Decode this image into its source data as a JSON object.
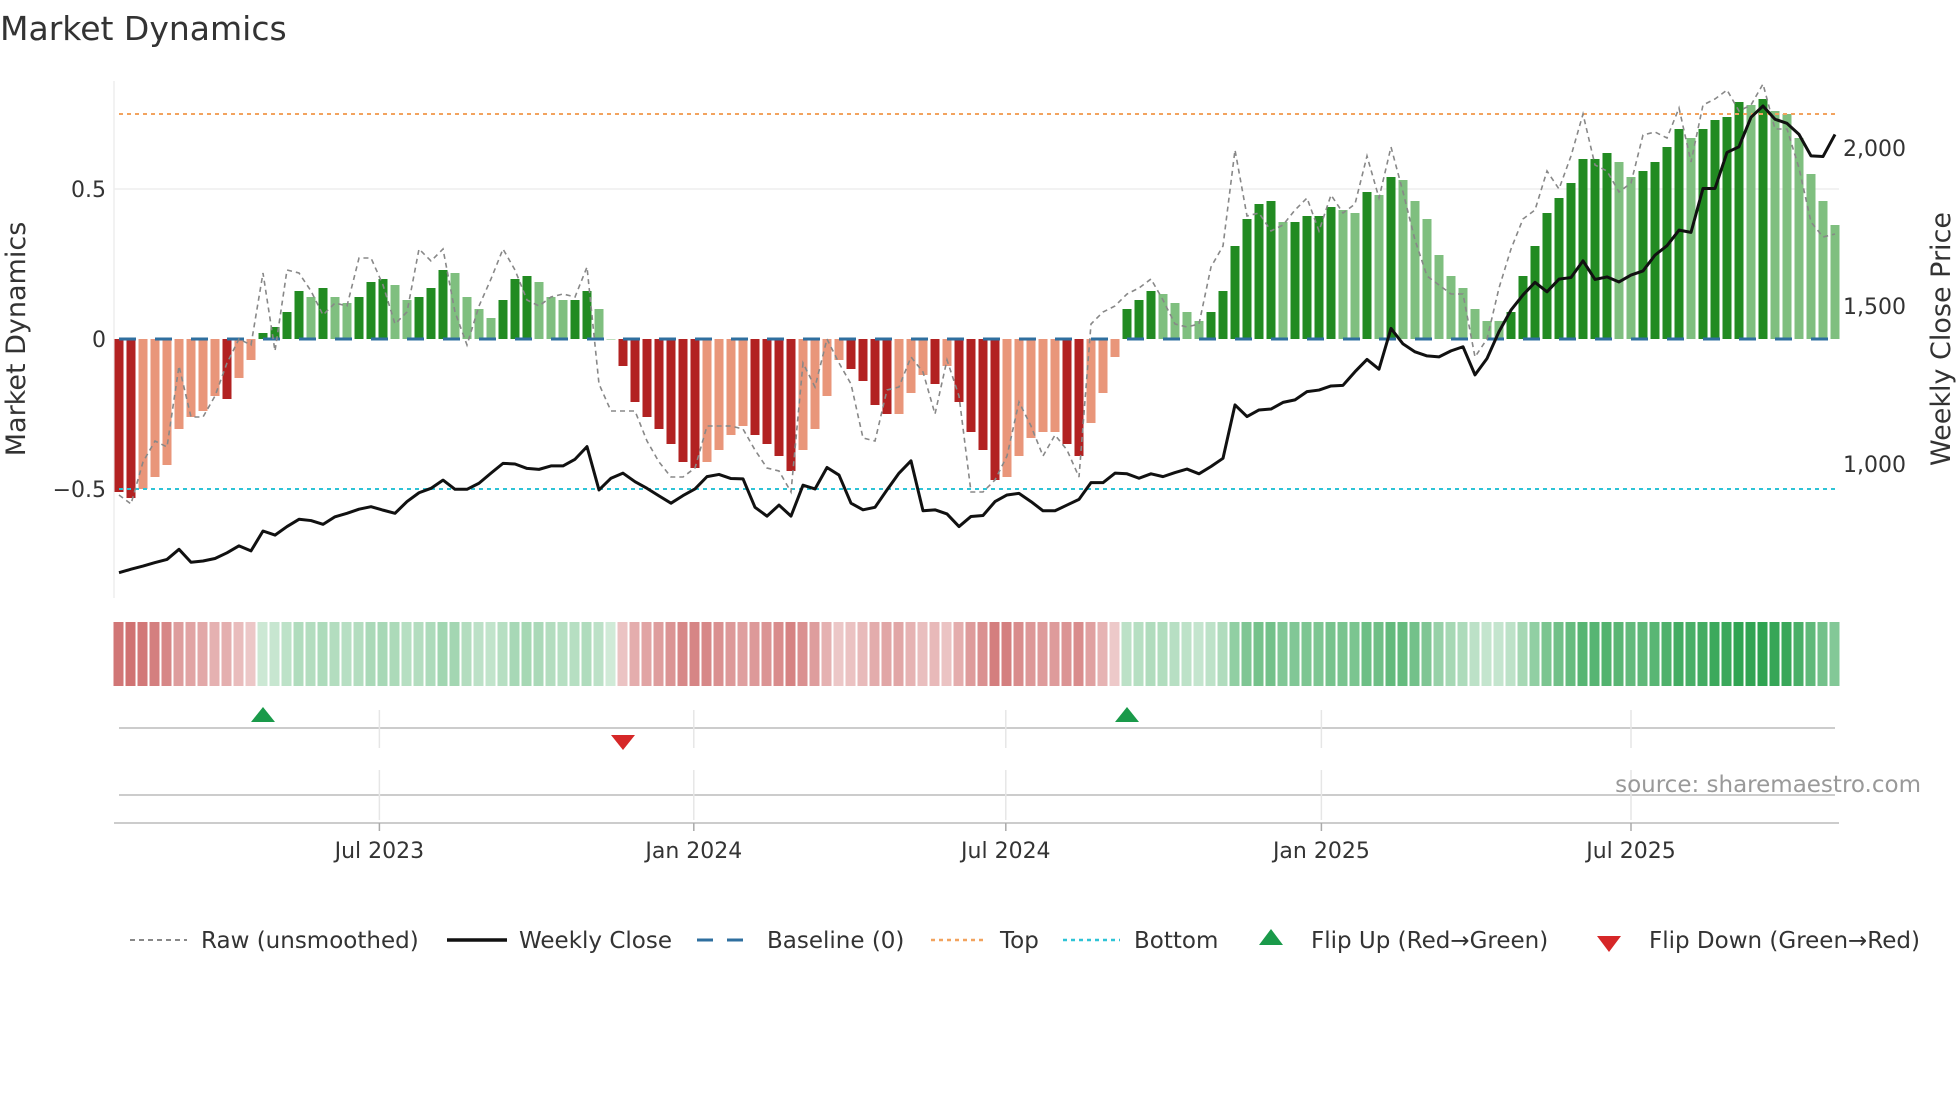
{
  "title": "Market Dynamics",
  "source": "source: sharemaestro.com",
  "colors": {
    "dark_red": "#b22222",
    "light_red": "#e9967a",
    "dark_green": "#228b22",
    "light_green": "#7fbf7f",
    "baseline": "#2f6f9f",
    "top": "#f2a35e",
    "bottom": "#2ec3d6",
    "price": "#111111",
    "raw": "#888888",
    "flip_up": "#1a9a4a",
    "flip_down": "#d62728"
  },
  "chart_data": {
    "type": "bar",
    "title": "Market Dynamics",
    "ylabel": "Market Dynamics",
    "y2label": "Weekly Close Price",
    "ylim": [
      -0.62,
      0.87
    ],
    "y_ticks": [
      {
        "value": 0.5,
        "label": "0.5"
      },
      {
        "value": 0,
        "label": "0"
      },
      {
        "value": -0.5,
        "label": "−0.5"
      }
    ],
    "y2_ticks": [
      {
        "value": 2000,
        "label": "2,000"
      },
      {
        "value": 1500,
        "label": "1,500"
      },
      {
        "value": 1000,
        "label": "1,000"
      }
    ],
    "x_ticks": [
      {
        "week_index": 21.7,
        "label": "Jul 2023"
      },
      {
        "week_index": 47.9,
        "label": "Jan 2024"
      },
      {
        "week_index": 73.9,
        "label": "Jul 2024"
      },
      {
        "week_index": 100.2,
        "label": "Jan 2025"
      },
      {
        "week_index": 126.0,
        "label": "Jul 2025"
      }
    ],
    "thresholds": {
      "baseline": 0,
      "top": 0.75,
      "bottom": -0.5
    },
    "smoothed": [
      -0.51,
      -0.53,
      -0.5,
      -0.46,
      -0.42,
      -0.3,
      -0.26,
      -0.24,
      -0.19,
      -0.2,
      -0.13,
      -0.07,
      0.02,
      0.04,
      0.09,
      0.16,
      0.14,
      0.17,
      0.14,
      0.12,
      0.14,
      0.19,
      0.2,
      0.18,
      0.13,
      0.14,
      0.17,
      0.23,
      0.22,
      0.14,
      0.1,
      0.07,
      0.13,
      0.2,
      0.21,
      0.19,
      0.14,
      0.13,
      0.13,
      0.16,
      0.1,
      0.0,
      -0.09,
      -0.21,
      -0.26,
      -0.3,
      -0.35,
      -0.41,
      -0.43,
      -0.41,
      -0.37,
      -0.32,
      -0.29,
      -0.32,
      -0.35,
      -0.39,
      -0.44,
      -0.37,
      -0.3,
      -0.19,
      -0.07,
      -0.1,
      -0.14,
      -0.22,
      -0.25,
      -0.25,
      -0.18,
      -0.12,
      -0.15,
      -0.09,
      -0.21,
      -0.31,
      -0.37,
      -0.47,
      -0.46,
      -0.39,
      -0.33,
      -0.31,
      -0.31,
      -0.35,
      -0.39,
      -0.28,
      -0.18,
      -0.06,
      0.1,
      0.13,
      0.16,
      0.15,
      0.12,
      0.09,
      0.06,
      0.09,
      0.16,
      0.31,
      0.4,
      0.45,
      0.46,
      0.39,
      0.39,
      0.41,
      0.41,
      0.44,
      0.43,
      0.42,
      0.49,
      0.48,
      0.54,
      0.53,
      0.46,
      0.4,
      0.28,
      0.21,
      0.17,
      0.1,
      0.06,
      0.06,
      0.09,
      0.21,
      0.31,
      0.42,
      0.47,
      0.52,
      0.6,
      0.6,
      0.62,
      0.59,
      0.54,
      0.56,
      0.59,
      0.64,
      0.7,
      0.67,
      0.7,
      0.73,
      0.74,
      0.79,
      0.78,
      0.8,
      0.76,
      0.75,
      0.67,
      0.55,
      0.46,
      0.38
    ],
    "strong": [
      1,
      1,
      0,
      0,
      0,
      0,
      0,
      0,
      0,
      1,
      0,
      0,
      1,
      1,
      1,
      1,
      0,
      1,
      0,
      0,
      1,
      1,
      1,
      0,
      0,
      1,
      1,
      1,
      0,
      0,
      0,
      0,
      1,
      1,
      1,
      0,
      0,
      0,
      1,
      1,
      0,
      0,
      1,
      1,
      1,
      1,
      1,
      1,
      1,
      0,
      0,
      0,
      0,
      1,
      1,
      1,
      1,
      0,
      0,
      0,
      0,
      1,
      1,
      1,
      1,
      0,
      0,
      0,
      1,
      0,
      1,
      1,
      1,
      1,
      0,
      0,
      0,
      0,
      0,
      1,
      1,
      0,
      0,
      0,
      1,
      1,
      1,
      0,
      0,
      0,
      0,
      1,
      1,
      1,
      1,
      1,
      1,
      0,
      1,
      1,
      1,
      1,
      0,
      0,
      1,
      0,
      1,
      0,
      0,
      0,
      0,
      0,
      0,
      0,
      0,
      0,
      1,
      1,
      1,
      1,
      1,
      1,
      1,
      1,
      1,
      0,
      0,
      1,
      1,
      1,
      1,
      0,
      1,
      1,
      1,
      1,
      0,
      1,
      0,
      0,
      0,
      0,
      0,
      0
    ],
    "raw": [
      -0.52,
      -0.55,
      -0.41,
      -0.34,
      -0.36,
      -0.09,
      -0.26,
      -0.26,
      -0.19,
      -0.08,
      0.0,
      -0.02,
      0.22,
      -0.04,
      0.23,
      0.22,
      0.16,
      0.08,
      0.12,
      0.11,
      0.27,
      0.27,
      0.18,
      0.05,
      0.09,
      0.3,
      0.26,
      0.3,
      0.09,
      -0.02,
      0.11,
      0.2,
      0.3,
      0.23,
      0.13,
      0.11,
      0.14,
      0.15,
      0.14,
      0.24,
      -0.15,
      -0.24,
      -0.24,
      -0.24,
      -0.34,
      -0.41,
      -0.46,
      -0.46,
      -0.43,
      -0.29,
      -0.29,
      -0.29,
      -0.3,
      -0.37,
      -0.43,
      -0.44,
      -0.51,
      -0.08,
      -0.16,
      0.0,
      -0.08,
      -0.15,
      -0.33,
      -0.34,
      -0.17,
      -0.16,
      -0.06,
      -0.11,
      -0.25,
      -0.07,
      -0.19,
      -0.51,
      -0.51,
      -0.47,
      -0.39,
      -0.21,
      -0.29,
      -0.39,
      -0.32,
      -0.37,
      -0.46,
      0.05,
      0.09,
      0.11,
      0.15,
      0.17,
      0.2,
      0.13,
      0.05,
      0.04,
      0.05,
      0.24,
      0.31,
      0.63,
      0.41,
      0.42,
      0.36,
      0.38,
      0.43,
      0.47,
      0.36,
      0.48,
      0.42,
      0.45,
      0.61,
      0.47,
      0.64,
      0.49,
      0.33,
      0.21,
      0.18,
      0.15,
      0.15,
      -0.06,
      0.0,
      0.17,
      0.3,
      0.4,
      0.43,
      0.56,
      0.5,
      0.61,
      0.75,
      0.58,
      0.56,
      0.49,
      0.52,
      0.68,
      0.69,
      0.67,
      0.77,
      0.59,
      0.78,
      0.8,
      0.83,
      0.76,
      0.78,
      0.85,
      0.7,
      0.7,
      0.57,
      0.39,
      0.34,
      0.35
    ],
    "weekly_close": [
      656,
      667,
      677,
      688,
      698,
      730,
      689,
      693,
      701,
      719,
      741,
      725,
      788,
      775,
      802,
      825,
      821,
      809,
      833,
      844,
      857,
      865,
      854,
      844,
      881,
      909,
      923,
      949,
      920,
      920,
      939,
      971,
      1002,
      1000,
      986,
      983,
      994,
      994,
      1015,
      1055,
      918,
      955,
      971,
      944,
      923,
      899,
      876,
      900,
      921,
      960,
      967,
      954,
      953,
      863,
      835,
      870,
      835,
      933,
      921,
      989,
      965,
      876,
      855,
      863,
      918,
      971,
      1010,
      852,
      855,
      842,
      802,
      834,
      837,
      881,
      902,
      907,
      881,
      852,
      852,
      870,
      888,
      941,
      941,
      971,
      969,
      955,
      969,
      960,
      973,
      984,
      969,
      992,
      1018,
      1187,
      1150,
      1171,
      1174,
      1195,
      1203,
      1229,
      1234,
      1247,
      1249,
      1292,
      1331,
      1300,
      1429,
      1380,
      1355,
      1342,
      1339,
      1358,
      1371,
      1282,
      1334,
      1419,
      1487,
      1535,
      1575,
      1545,
      1585,
      1590,
      1643,
      1584,
      1592,
      1576,
      1598,
      1611,
      1661,
      1691,
      1740,
      1733,
      1872,
      1872,
      1986,
      2004,
      2097,
      2133,
      2091,
      2078,
      2043,
      1975,
      1973,
      2043
    ],
    "flips": [
      {
        "week_index": 12,
        "type": "up"
      },
      {
        "week_index": 42,
        "type": "down"
      },
      {
        "week_index": 84,
        "type": "up"
      }
    ],
    "legend": {
      "placement": "bottom",
      "items": [
        "Raw (unsmoothed)",
        "Weekly Close",
        "Baseline (0)",
        "Top",
        "Bottom",
        "Flip Up (Red→Green)",
        "Flip Down (Green→Red)"
      ]
    }
  }
}
